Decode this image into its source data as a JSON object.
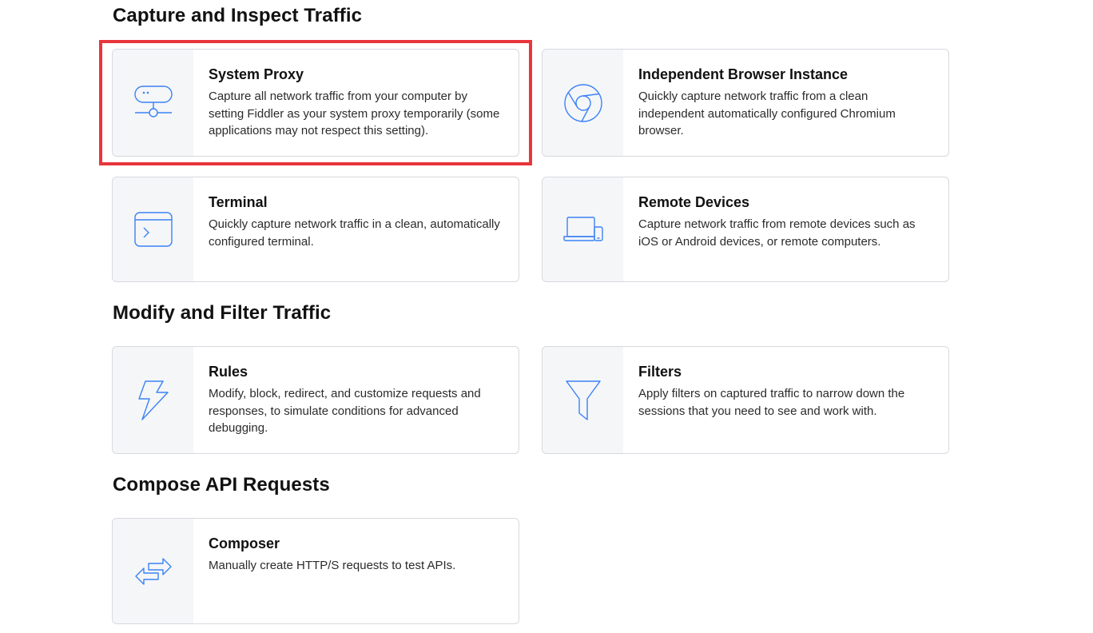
{
  "sections": [
    {
      "title": "Capture and Inspect Traffic",
      "cards": [
        {
          "title": "System Proxy",
          "icon": "network-proxy-icon",
          "description": "Capture all network traffic from your computer by setting Fiddler as your system proxy temporarily (some applications may not respect this setting)."
        },
        {
          "title": "Independent Browser Instance",
          "icon": "chromium-browser-icon",
          "description": "Quickly capture network traffic from a clean independent automatically configured Chromium browser."
        },
        {
          "title": "Terminal",
          "icon": "terminal-icon",
          "description": "Quickly capture network traffic in a clean, automatically configured terminal."
        },
        {
          "title": "Remote Devices",
          "icon": "laptop-phone-icon",
          "description": "Capture network traffic from remote devices such as iOS or Android devices, or remote computers."
        }
      ]
    },
    {
      "title": "Modify and Filter Traffic",
      "cards": [
        {
          "title": "Rules",
          "icon": "lightning-bolt-icon",
          "description": "Modify, block, redirect, and customize requests and responses, to simulate conditions for advanced debugging."
        },
        {
          "title": "Filters",
          "icon": "funnel-filter-icon",
          "description": "Apply filters on captured traffic to narrow down the sessions that you need to see and work with."
        }
      ]
    },
    {
      "title": "Compose API Requests",
      "cards": [
        {
          "title": "Composer",
          "icon": "swap-arrows-icon",
          "description": "Manually create HTTP/S requests to test APIs."
        }
      ]
    }
  ],
  "colors": {
    "icon_stroke": "#3b82f6",
    "highlight": "#e8363b",
    "icon_panel": "#f5f6f8",
    "card_border": "#d6d9de"
  }
}
